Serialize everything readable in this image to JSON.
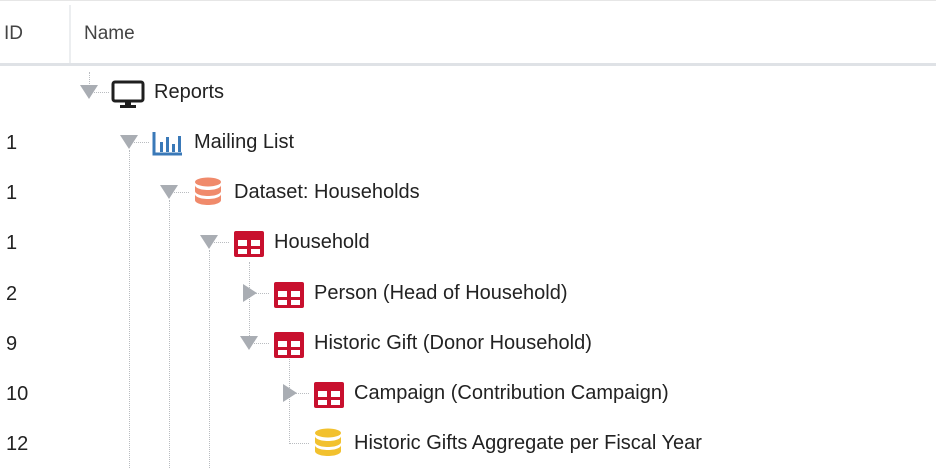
{
  "header": {
    "id_label": "ID",
    "name_label": "Name"
  },
  "rows": [
    {
      "id": "",
      "label": "Reports",
      "icon": "monitor-icon",
      "toggle": "expanded"
    },
    {
      "id": "1",
      "label": "Mailing List",
      "icon": "bar-chart-icon",
      "toggle": "expanded"
    },
    {
      "id": "1",
      "label": "Dataset: Households",
      "icon": "database-icon",
      "toggle": "expanded"
    },
    {
      "id": "1",
      "label": "Household",
      "icon": "table-icon",
      "toggle": "expanded"
    },
    {
      "id": "2",
      "label": "Person (Head of Household)",
      "icon": "table-icon",
      "toggle": "collapsed"
    },
    {
      "id": "9",
      "label": "Historic Gift (Donor Household)",
      "icon": "table-icon",
      "toggle": "expanded"
    },
    {
      "id": "10",
      "label": "Campaign (Contribution Campaign)",
      "icon": "table-icon",
      "toggle": "collapsed"
    },
    {
      "id": "12",
      "label": "Historic Gifts Aggregate per Fiscal Year",
      "icon": "aggregate-db-icon",
      "toggle": "none"
    }
  ],
  "colors": {
    "monitor": "#1f1f1f",
    "chart": "#3a79b8",
    "database": "#f08a6b",
    "table": "#c8102e",
    "aggregate": "#f2c12e",
    "toggle": "#a9adb3"
  }
}
